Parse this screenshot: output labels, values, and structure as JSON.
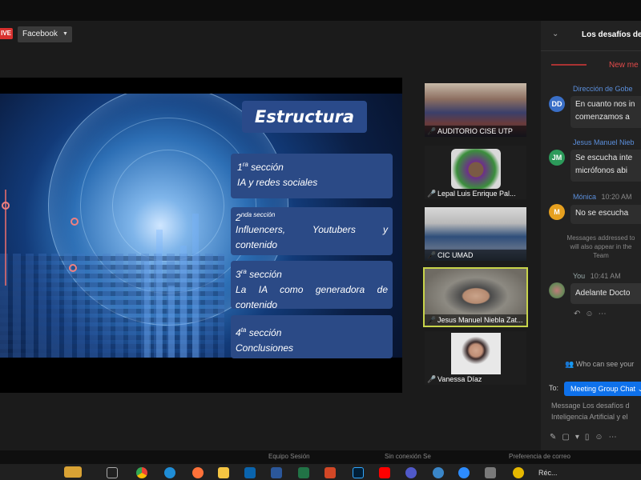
{
  "stream": {
    "live_label": "IVE",
    "platform": "Facebook"
  },
  "slide": {
    "title": "Estructura",
    "sections": [
      {
        "num": "1",
        "sup": "ra",
        "word": " sección",
        "text": "IA y redes sociales"
      },
      {
        "num": "2",
        "sup": "nda sección",
        "word": "",
        "text": "Influencers, Youtubers y contenido"
      },
      {
        "num": "3",
        "sup": "ra",
        "word": " sección",
        "text": "La IA como generadora de contenido"
      },
      {
        "num": "4",
        "sup": "ta",
        "word": " sección",
        "text": "Conclusiones"
      }
    ]
  },
  "participants": [
    {
      "name": "AUDITORIO CISE UTP"
    },
    {
      "name": "Lepal Luis Enrique Pal..."
    },
    {
      "name": "CIC UMAD"
    },
    {
      "name": "Jesus Manuel Niebla Zat..."
    },
    {
      "name": "Vanessa Díaz"
    }
  ],
  "chat": {
    "title": "Los desafíos de",
    "new_messages": "New me",
    "messages": [
      {
        "initials": "DD",
        "color": "#3a6fc7",
        "sender": "Dirección de Gobe",
        "time": "",
        "lines": [
          "En cuanto nos in",
          "comenzamos a"
        ]
      },
      {
        "initials": "JM",
        "color": "#2c9a5a",
        "sender": "Jesus Manuel Nieb",
        "time": "",
        "lines": [
          "Se escucha inte",
          "micrófonos abi"
        ]
      },
      {
        "initials": "M",
        "color": "#e6a01f",
        "sender": "Mónica",
        "time": "10:20 AM",
        "lines": [
          "No se escucha"
        ]
      }
    ],
    "system_note": [
      "Messages addressed to",
      "will also appear in the",
      "Team"
    ],
    "you": {
      "sender": "You",
      "time": "10:41 AM",
      "text": "Adelante Docto"
    },
    "who_can_see": "Who can see your",
    "to_label": "To:",
    "recipient": "Meeting Group Chat",
    "composer": [
      "Message Los desafíos d",
      "Inteligencia Artificial y el"
    ]
  },
  "window_strip": [
    "Equipo Sesión",
    "Sin conexión Se",
    "Preferencia de correo"
  ],
  "taskbar": {
    "label": "Réc..."
  }
}
